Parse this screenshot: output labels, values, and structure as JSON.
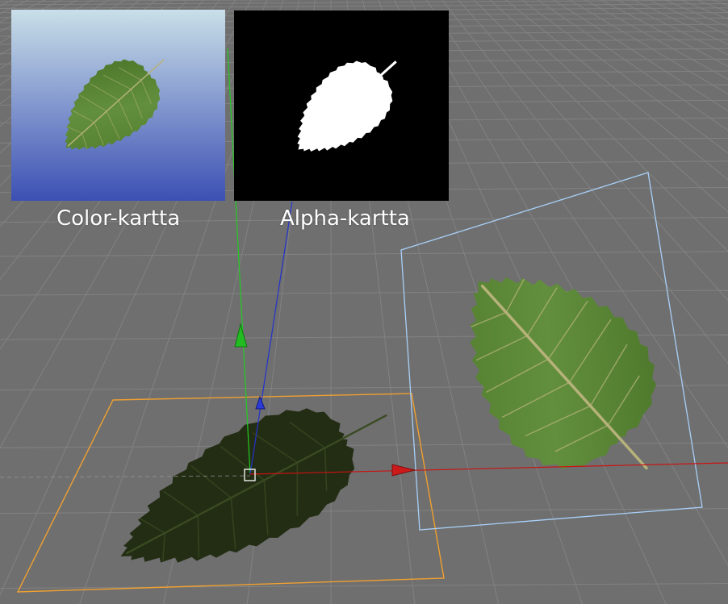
{
  "viewport": {
    "background": "#6f6f6f",
    "grid_color": "#828282"
  },
  "color_map": {
    "caption": "Color-kartta",
    "gradient_top": "#c9dfe8",
    "gradient_bottom": "#3c50b4"
  },
  "alpha_map": {
    "caption": "Alpha-kartta",
    "background": "#000000",
    "shape_color": "#ffffff"
  },
  "leaf": {
    "fill": "#5d8a3a",
    "vein": "#c7c08a",
    "shadow_fill": "#232d14"
  },
  "selection": {
    "ground_plane_color": "#f0a030",
    "vertical_plane_color": "#a8d0f8"
  },
  "gizmo": {
    "x_axis_color": "#cc1111",
    "y_axis_color": "#22cc22",
    "z_axis_color": "#2233cc"
  }
}
